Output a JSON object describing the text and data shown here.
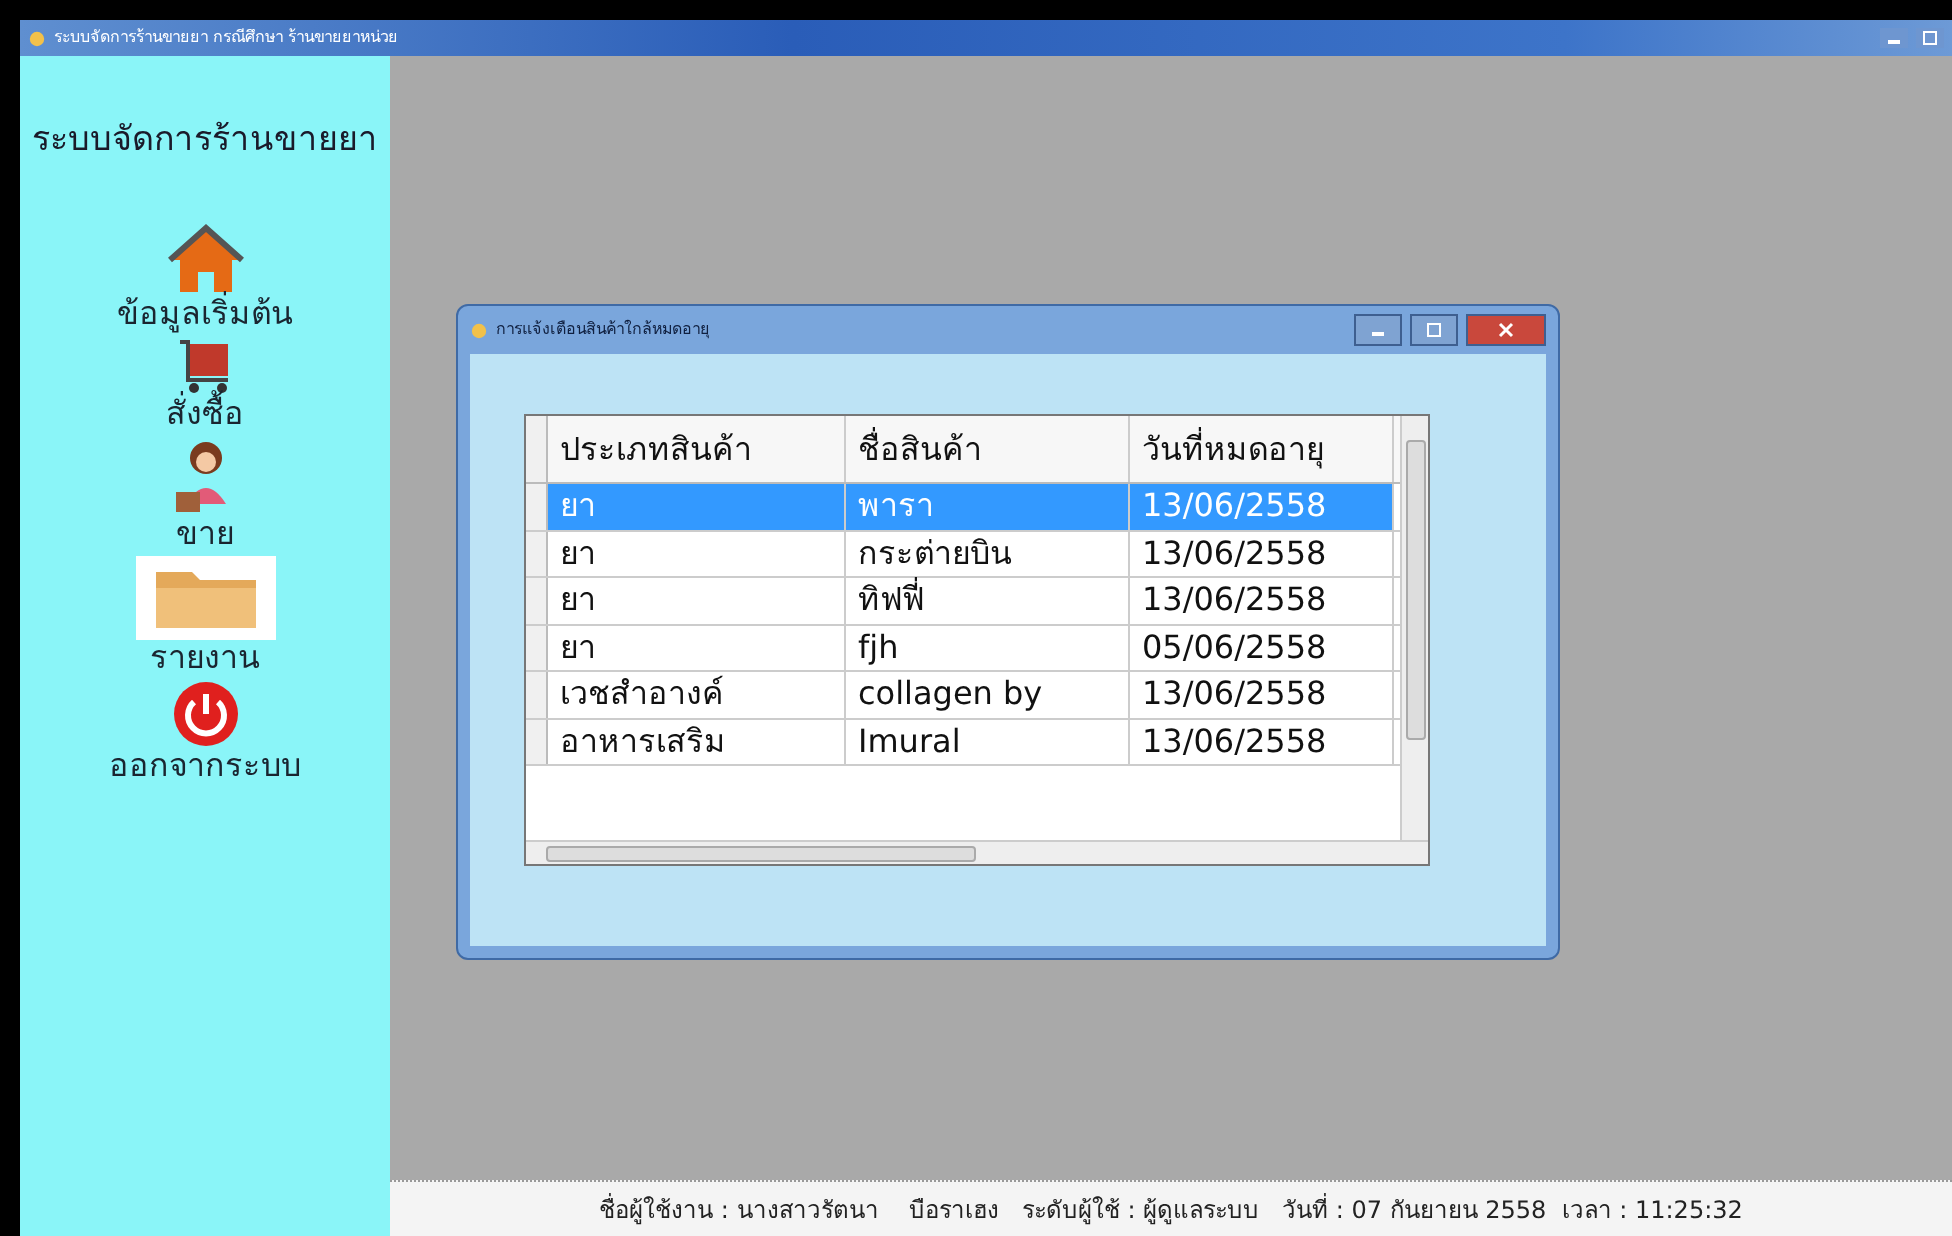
{
  "window": {
    "title": "ระบบจัดการร้านขายยา กรณีศึกษา ร้านขายยาหน่วย"
  },
  "sidebar": {
    "title": "ระบบจัดการร้านขายยา",
    "items": [
      {
        "kind": "home",
        "label": "ข้อมูลเริ่มต้น"
      },
      {
        "kind": "cart",
        "label": "สั่งซื้อ"
      },
      {
        "kind": "seller",
        "label": "ขาย"
      },
      {
        "kind": "folder",
        "label": "รายงาน"
      },
      {
        "kind": "power",
        "label": "ออกจากระบบ"
      }
    ]
  },
  "dialog": {
    "title": "การแจ้งเตือนสินค้าใกล้หมดอายุ",
    "table": {
      "columns": [
        "ประเภทสินค้า",
        "ชื่อสินค้า",
        "วันที่หมดอายุ"
      ],
      "rows": [
        {
          "cells": [
            "ยา",
            "พารา",
            "13/06/2558"
          ],
          "selected": true
        },
        {
          "cells": [
            "ยา",
            "กระต่ายบิน",
            "13/06/2558"
          ],
          "selected": false
        },
        {
          "cells": [
            "ยา",
            "ทิฟฟี่",
            "13/06/2558"
          ],
          "selected": false
        },
        {
          "cells": [
            "ยา",
            "fjh",
            "05/06/2558"
          ],
          "selected": false
        },
        {
          "cells": [
            "เวชสำอางค์",
            "collagen by",
            "13/06/2558"
          ],
          "selected": false
        },
        {
          "cells": [
            "อาหารเสริม",
            "Imural",
            "13/06/2558"
          ],
          "selected": false
        }
      ]
    }
  },
  "status_bar": {
    "text": "ชื่อผู้ใช้งาน : นางสาวรัตนา    บือราเฮง   ระดับผู้ใช้ : ผู้ดูแลระบบ   วันที่ : 07 กันยายน 2558  เวลา : 11:25:32"
  }
}
